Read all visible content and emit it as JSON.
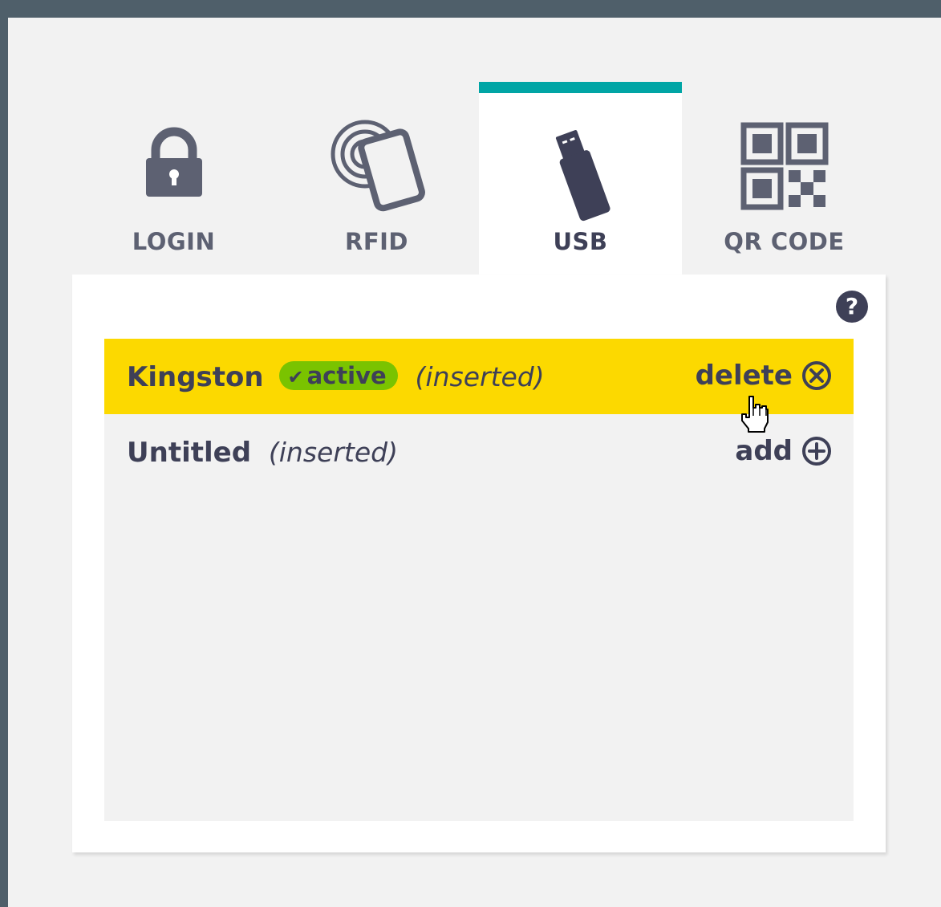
{
  "tabs": [
    {
      "label": "LOGIN",
      "icon": "lock-icon",
      "active": false
    },
    {
      "label": "RFID",
      "icon": "rfid-card-icon",
      "active": false
    },
    {
      "label": "USB",
      "icon": "usb-drive-icon",
      "active": true
    },
    {
      "label": "QR CODE",
      "icon": "qr-code-icon",
      "active": false
    }
  ],
  "help": {
    "label": "?"
  },
  "devices": [
    {
      "name": "Kingston",
      "badge": "active",
      "state": "(inserted)",
      "action": "delete",
      "action_icon": "delete-circle-x-icon"
    },
    {
      "name": "Untitled",
      "state": "(inserted)",
      "action": "add",
      "action_icon": "add-circle-plus-icon"
    }
  ],
  "colors": {
    "frame": "#4f5f6a",
    "accent": "#00a5a5",
    "selected_row": "#fcd900",
    "active_badge": "#7ac300",
    "text": "#3e4057"
  }
}
